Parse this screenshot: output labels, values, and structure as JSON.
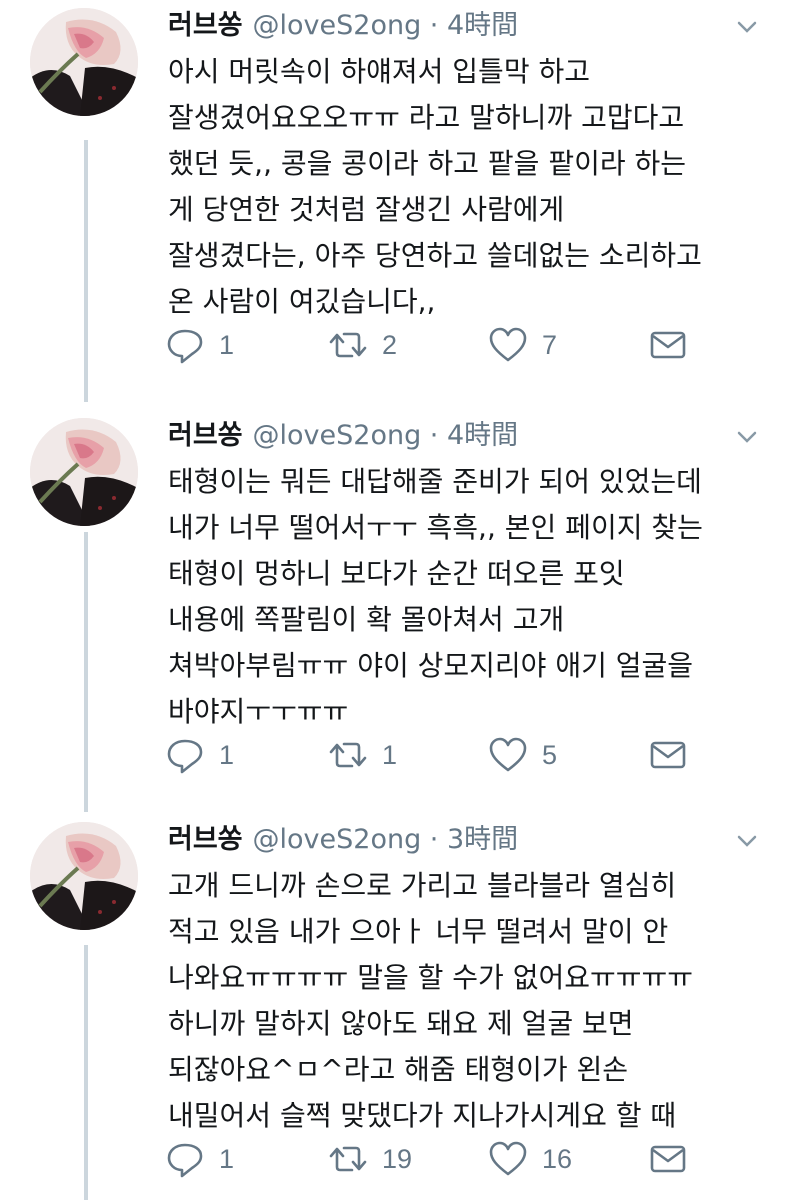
{
  "tweets": [
    {
      "name": "러브쏭",
      "handle": "@loveS2ong · 4時間",
      "lines": [
        "아시 머릿속이 하얘져서 입틀막 하고",
        "잘생겼어요오오ㅠㅠ 라고 말하니까 고맙다고",
        "했던 듯,, 콩을 콩이라 하고 팥을 팥이라 하는",
        "게 당연한 것처럼 잘생긴 사람에게",
        "잘생겼다는, 아주 당연하고 쓸데없는 소리하고",
        "온 사람이 여깄습니다,,"
      ],
      "replies": "1",
      "retweets": "2",
      "likes": "7"
    },
    {
      "name": "러브쏭",
      "handle": "@loveS2ong · 4時間",
      "lines": [
        "태형이는 뭐든 대답해줄 준비가 되어 있었는데",
        "내가 너무 떨어서ㅜㅜ 흑흑,, 본인 페이지 찾는",
        "태형이 멍하니 보다가 순간 떠오른 포잇",
        "내용에 쪽팔림이 확 몰아쳐서 고개",
        "쳐박아부림ㅠㅠ 야이 상모지리야 애기 얼굴을",
        "바야지ㅜㅜㅠㅠ"
      ],
      "replies": "1",
      "retweets": "1",
      "likes": "5"
    },
    {
      "name": "러브쏭",
      "handle": "@loveS2ong · 3時間",
      "lines": [
        "고개 드니까 손으로 가리고 블라블라 열심히",
        "적고 있음 내가 으아ㅏ 너무 떨려서 말이 안",
        "나와요ㅠㅠㅠㅠ 말을 할 수가 없어요ㅠㅠㅠㅠ",
        "하니까 말하지 않아도 돼요 제 얼굴 보면",
        "되잖아요^ㅁ^라고 해줌 태형이가 왼손",
        "내밀어서 슬쩍 맞댔다가 지나가시게요 할 때"
      ],
      "replies": "1",
      "retweets": "19",
      "likes": "16"
    }
  ],
  "icons": {
    "reply": "reply-icon",
    "retweet": "retweet-icon",
    "like": "heart-icon",
    "dm": "envelope-icon",
    "more": "chevron-down-icon"
  },
  "colors": {
    "text": "#14171a",
    "secondary": "#657786",
    "thread_line": "#ccd6dd"
  }
}
